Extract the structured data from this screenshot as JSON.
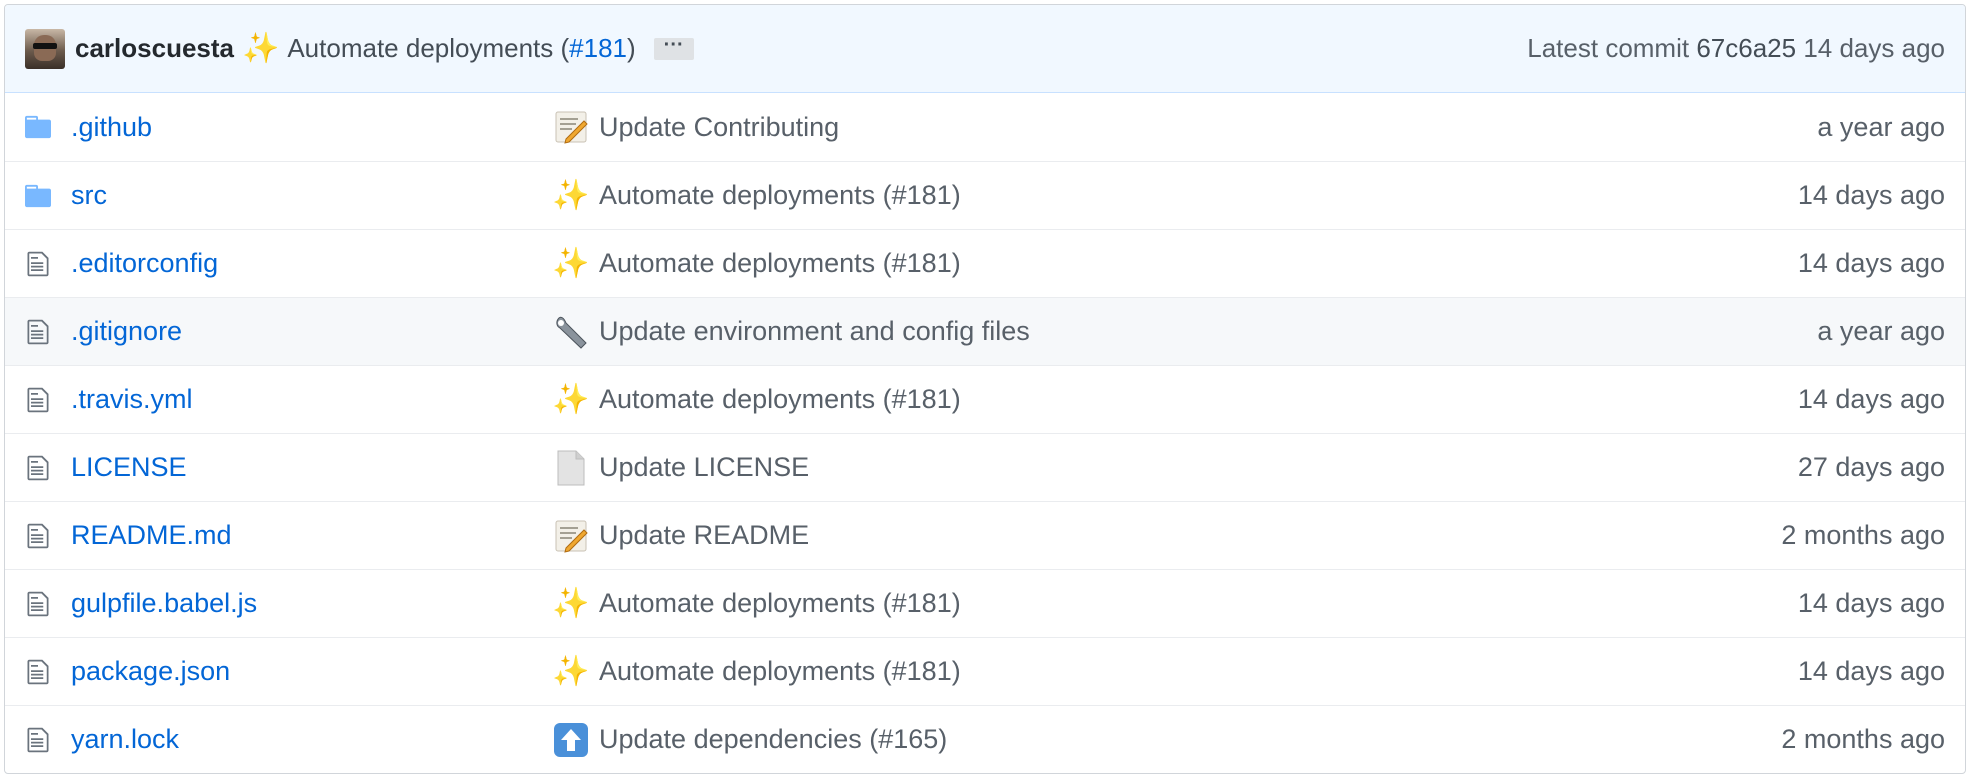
{
  "commit_tease": {
    "author": "carloscuesta",
    "emoji": "sparkles-emoji",
    "message_prefix": "Automate deployments (",
    "pr": "#181",
    "message_suffix": ")",
    "ellipsis": "···",
    "latest_label": "Latest commit",
    "sha": "67c6a25",
    "age": "14 days ago"
  },
  "files": [
    {
      "type": "dir",
      "name": ".github",
      "emoji": "memo-emoji",
      "message": "Update Contributing",
      "age": "a year ago"
    },
    {
      "type": "dir",
      "name": "src",
      "emoji": "sparkles-emoji",
      "message": "Automate deployments (#181)",
      "age": "14 days ago"
    },
    {
      "type": "file",
      "name": ".editorconfig",
      "emoji": "sparkles-emoji",
      "message": "Automate deployments (#181)",
      "age": "14 days ago"
    },
    {
      "type": "file",
      "name": ".gitignore",
      "emoji": "wrench-emoji",
      "message": "Update environment and config files",
      "age": "a year ago"
    },
    {
      "type": "file",
      "name": ".travis.yml",
      "emoji": "sparkles-emoji",
      "message": "Automate deployments (#181)",
      "age": "14 days ago"
    },
    {
      "type": "file",
      "name": "LICENSE",
      "emoji": "page-emoji",
      "message": "Update LICENSE",
      "age": "27 days ago"
    },
    {
      "type": "file",
      "name": "README.md",
      "emoji": "memo-emoji",
      "message": "Update README",
      "age": "2 months ago"
    },
    {
      "type": "file",
      "name": "gulpfile.babel.js",
      "emoji": "sparkles-emoji",
      "message": "Automate deployments (#181)",
      "age": "14 days ago"
    },
    {
      "type": "file",
      "name": "package.json",
      "emoji": "sparkles-emoji",
      "message": "Automate deployments (#181)",
      "age": "14 days ago"
    },
    {
      "type": "file",
      "name": "yarn.lock",
      "emoji": "arrow-up-emoji",
      "message": "Update dependencies (#165)",
      "age": "2 months ago"
    }
  ],
  "colors": {
    "link": "#0366d6",
    "tease_bg": "#f1f8ff",
    "folder": "#79b8ff",
    "hover_row_bg": "#f6f8fa"
  }
}
